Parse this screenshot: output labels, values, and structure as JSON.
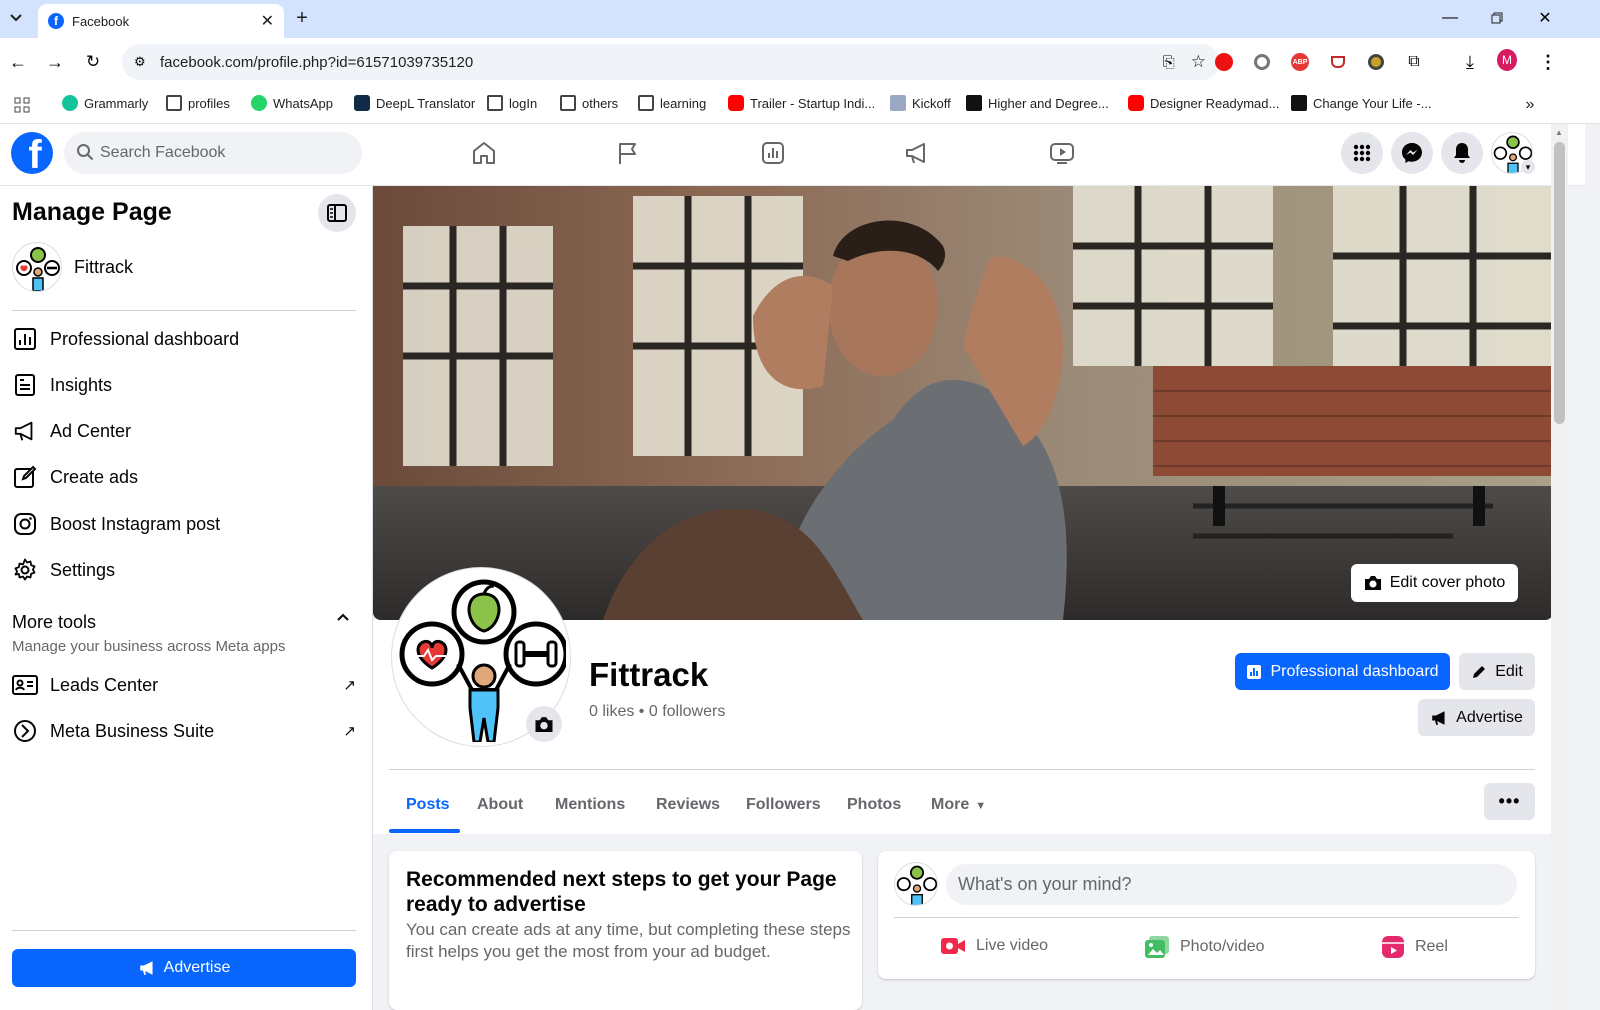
{
  "browser": {
    "tab_title": "Facebook",
    "url": "facebook.com/profile.php?id=61571039735120",
    "bookmarks": [
      {
        "label": "Grammarly",
        "icon": "grammarly-icon"
      },
      {
        "label": "profiles",
        "icon": "folder-icon"
      },
      {
        "label": "WhatsApp",
        "icon": "whatsapp-icon"
      },
      {
        "label": "DeepL Translator",
        "icon": "deepl-icon"
      },
      {
        "label": "logIn",
        "icon": "folder-icon"
      },
      {
        "label": "others",
        "icon": "folder-icon"
      },
      {
        "label": "learning",
        "icon": "folder-icon"
      },
      {
        "label": "Trailer - Startup Indi...",
        "icon": "youtube-icon"
      },
      {
        "label": "Kickoff",
        "icon": "doc-icon"
      },
      {
        "label": "Higher and Degree...",
        "icon": "site-icon"
      },
      {
        "label": "Designer Readymad...",
        "icon": "youtube-icon"
      },
      {
        "label": "Change Your Life -...",
        "icon": "site-icon"
      }
    ],
    "profile_initial": "M"
  },
  "fb": {
    "search_placeholder": "Search Facebook"
  },
  "sidebar": {
    "title": "Manage Page",
    "page_name": "Fittrack",
    "items": [
      {
        "label": "Professional dashboard",
        "icon": "dashboard-icon"
      },
      {
        "label": "Insights",
        "icon": "insights-icon"
      },
      {
        "label": "Ad Center",
        "icon": "megaphone-icon"
      },
      {
        "label": "Create ads",
        "icon": "edit-icon"
      },
      {
        "label": "Boost Instagram post",
        "icon": "instagram-icon"
      },
      {
        "label": "Settings",
        "icon": "gear-icon"
      }
    ],
    "more_tools_title": "More tools",
    "more_tools_subtitle": "Manage your business across Meta apps",
    "tools": [
      {
        "label": "Leads Center",
        "icon": "leads-icon"
      },
      {
        "label": "Meta Business Suite",
        "icon": "meta-icon"
      }
    ],
    "advertise_label": "Advertise"
  },
  "profile": {
    "name": "Fittrack",
    "stats": "0 likes • 0 followers",
    "edit_cover_label": "Edit cover photo",
    "dashboard_btn": "Professional dashboard",
    "edit_btn": "Edit",
    "advertise_btn": "Advertise",
    "tabs": [
      "Posts",
      "About",
      "Mentions",
      "Reviews",
      "Followers",
      "Photos",
      "More"
    ]
  },
  "recommend": {
    "title": "Recommended next steps to get your Page ready to advertise",
    "body": "You can create ads at any time, but completing these steps first helps you get the most from your ad budget."
  },
  "composer": {
    "placeholder": "What's on your mind?",
    "actions": [
      "Live video",
      "Photo/video",
      "Reel"
    ]
  },
  "colors": {
    "fb_blue": "#0866ff",
    "tab_bg": "#d3e3fd"
  }
}
